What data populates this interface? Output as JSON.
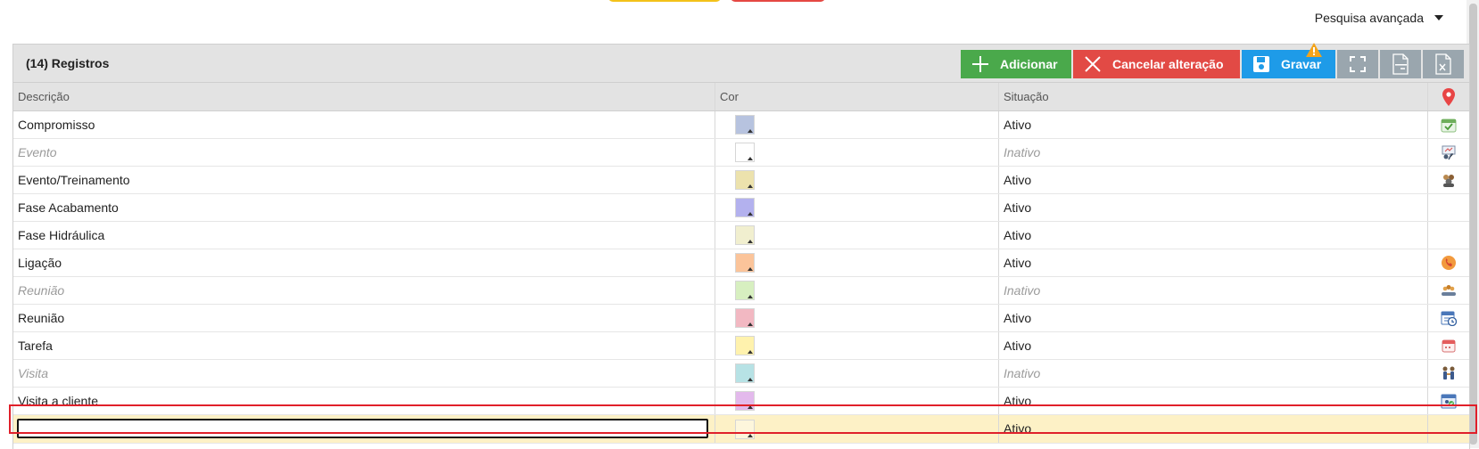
{
  "top_bar": {
    "advanced_search_label": "Pesquisa avançada"
  },
  "grid": {
    "title": "(14) Registros",
    "toolbar": {
      "add_label": "Adicionar",
      "cancel_label": "Cancelar alteração",
      "save_label": "Gravar",
      "fullscreen_icon": "fullscreen-icon",
      "csv_icon": "csv-export-icon",
      "xls_icon": "xls-export-icon"
    },
    "columns": {
      "description": "Descrição",
      "color": "Cor",
      "status": "Situação",
      "icon": "location-pin-icon"
    },
    "rows": [
      {
        "description": "Compromisso",
        "color": "#b7c3df",
        "status": "Ativo",
        "active": true,
        "icon": "calendar-check-icon"
      },
      {
        "description": "Evento",
        "color": "#ffffff",
        "status": "Inativo",
        "active": false,
        "icon": "presentation-icon"
      },
      {
        "description": "Evento/Treinamento",
        "color": "#ece2ad",
        "status": "Ativo",
        "active": true,
        "icon": "group-training-icon"
      },
      {
        "description": "Fase Acabamento",
        "color": "#b3b1ee",
        "status": "Ativo",
        "active": true,
        "icon": ""
      },
      {
        "description": "Fase Hidráulica",
        "color": "#f1efcf",
        "status": "Ativo",
        "active": true,
        "icon": ""
      },
      {
        "description": "Ligação",
        "color": "#fbc49a",
        "status": "Ativo",
        "active": true,
        "icon": "phone-call-icon"
      },
      {
        "description": "Reunião",
        "color": "#d7efc0",
        "status": "Inativo",
        "active": false,
        "icon": "meeting-people-icon"
      },
      {
        "description": "Reunião",
        "color": "#f2b8c2",
        "status": "Ativo",
        "active": true,
        "icon": "calendar-clock-icon"
      },
      {
        "description": "Tarefa",
        "color": "#fff2ad",
        "status": "Ativo",
        "active": true,
        "icon": "task-calendar-icon"
      },
      {
        "description": "Visita",
        "color": "#b7e2e5",
        "status": "Inativo",
        "active": false,
        "icon": "visitors-icon"
      },
      {
        "description": "Visita a cliente",
        "color": "#e3b9ec",
        "status": "Ativo",
        "active": true,
        "icon": "client-visit-icon"
      }
    ],
    "new_row": {
      "description": "",
      "color": "#fdf6dc",
      "status": "Ativo"
    }
  },
  "colors": {
    "add": "#4aa94b",
    "cancel": "#e24a45",
    "save": "#1e9be8",
    "tool": "#9aa6ae",
    "highlight": "#e0202a",
    "new_row_bg": "#fdf1c6"
  }
}
